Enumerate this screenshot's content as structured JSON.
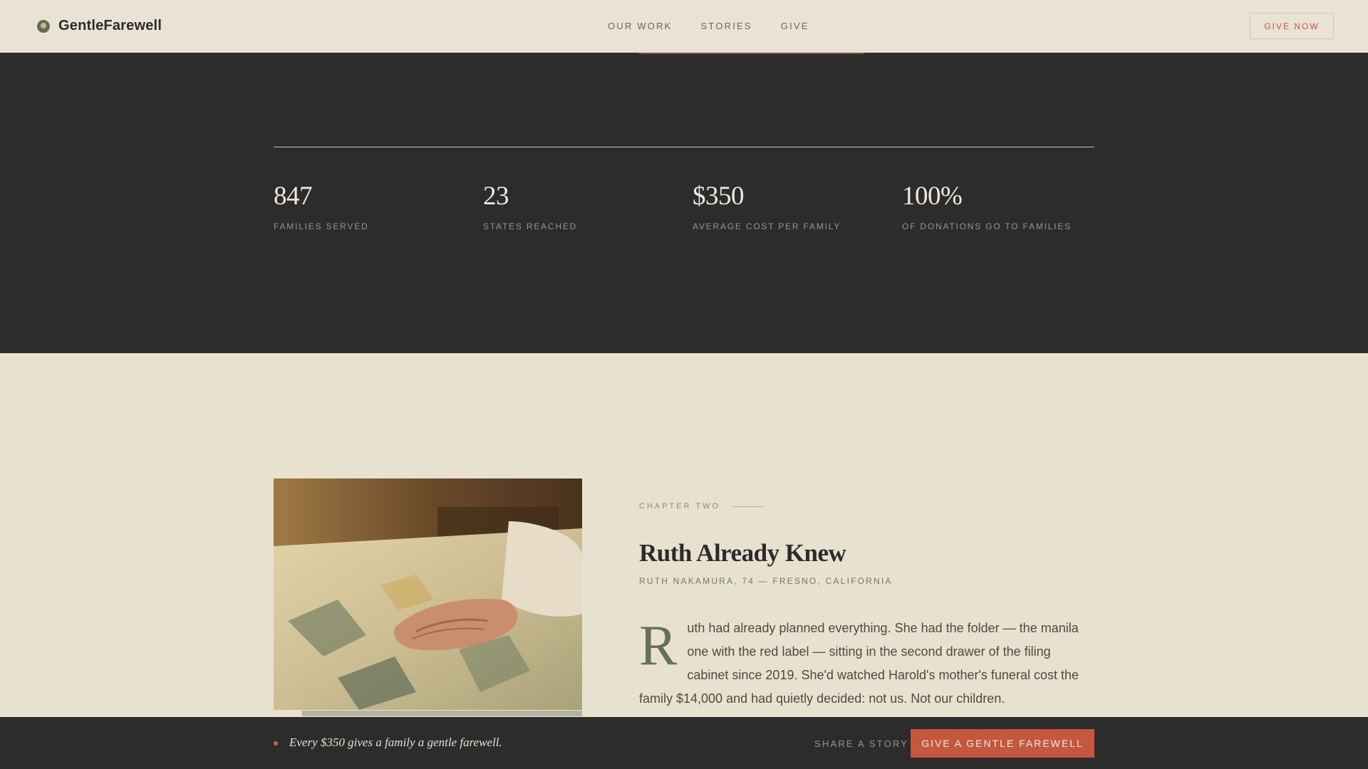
{
  "header": {
    "brand_name": "GentleFarewell",
    "brand_icon": "leaf-icon",
    "nav": [
      {
        "label": "OUR WORK"
      },
      {
        "label": "STORIES"
      },
      {
        "label": "GIVE"
      }
    ],
    "give_now_label": "GIVE NOW"
  },
  "stats": [
    {
      "value": "847",
      "label": "FAMILIES SERVED"
    },
    {
      "value": "23",
      "label": "STATES REACHED"
    },
    {
      "value": "$350",
      "label": "AVERAGE COST PER FAMILY"
    },
    {
      "value": "100%",
      "label": "OF DONATIONS GO TO FAMILIES"
    }
  ],
  "chapter": {
    "kicker": "CHAPTER TWO",
    "title": "Ruth Already Knew",
    "byline": "RUTH NAKAMURA, 74 — FRESNO, CALIFORNIA",
    "dropcap": "R",
    "body": "uth had already planned everything. She had the folder — the manila one with the red label — sitting in the second drawer of the filing cabinet since 2019. She'd watched Harold's mother's funeral cost the family $14,000 and had quietly decided: not us. Not our children."
  },
  "bottom_bar": {
    "tagline": "Every $350 gives a family a gentle farewell.",
    "share_label": "SHARE A STORY",
    "cta_label": "GIVE A GENTLE FAREWELL"
  },
  "colors": {
    "accent": "#c5573f",
    "dark": "#2c2c2c",
    "cream": "#e8e1d0",
    "sage": "#647257"
  }
}
